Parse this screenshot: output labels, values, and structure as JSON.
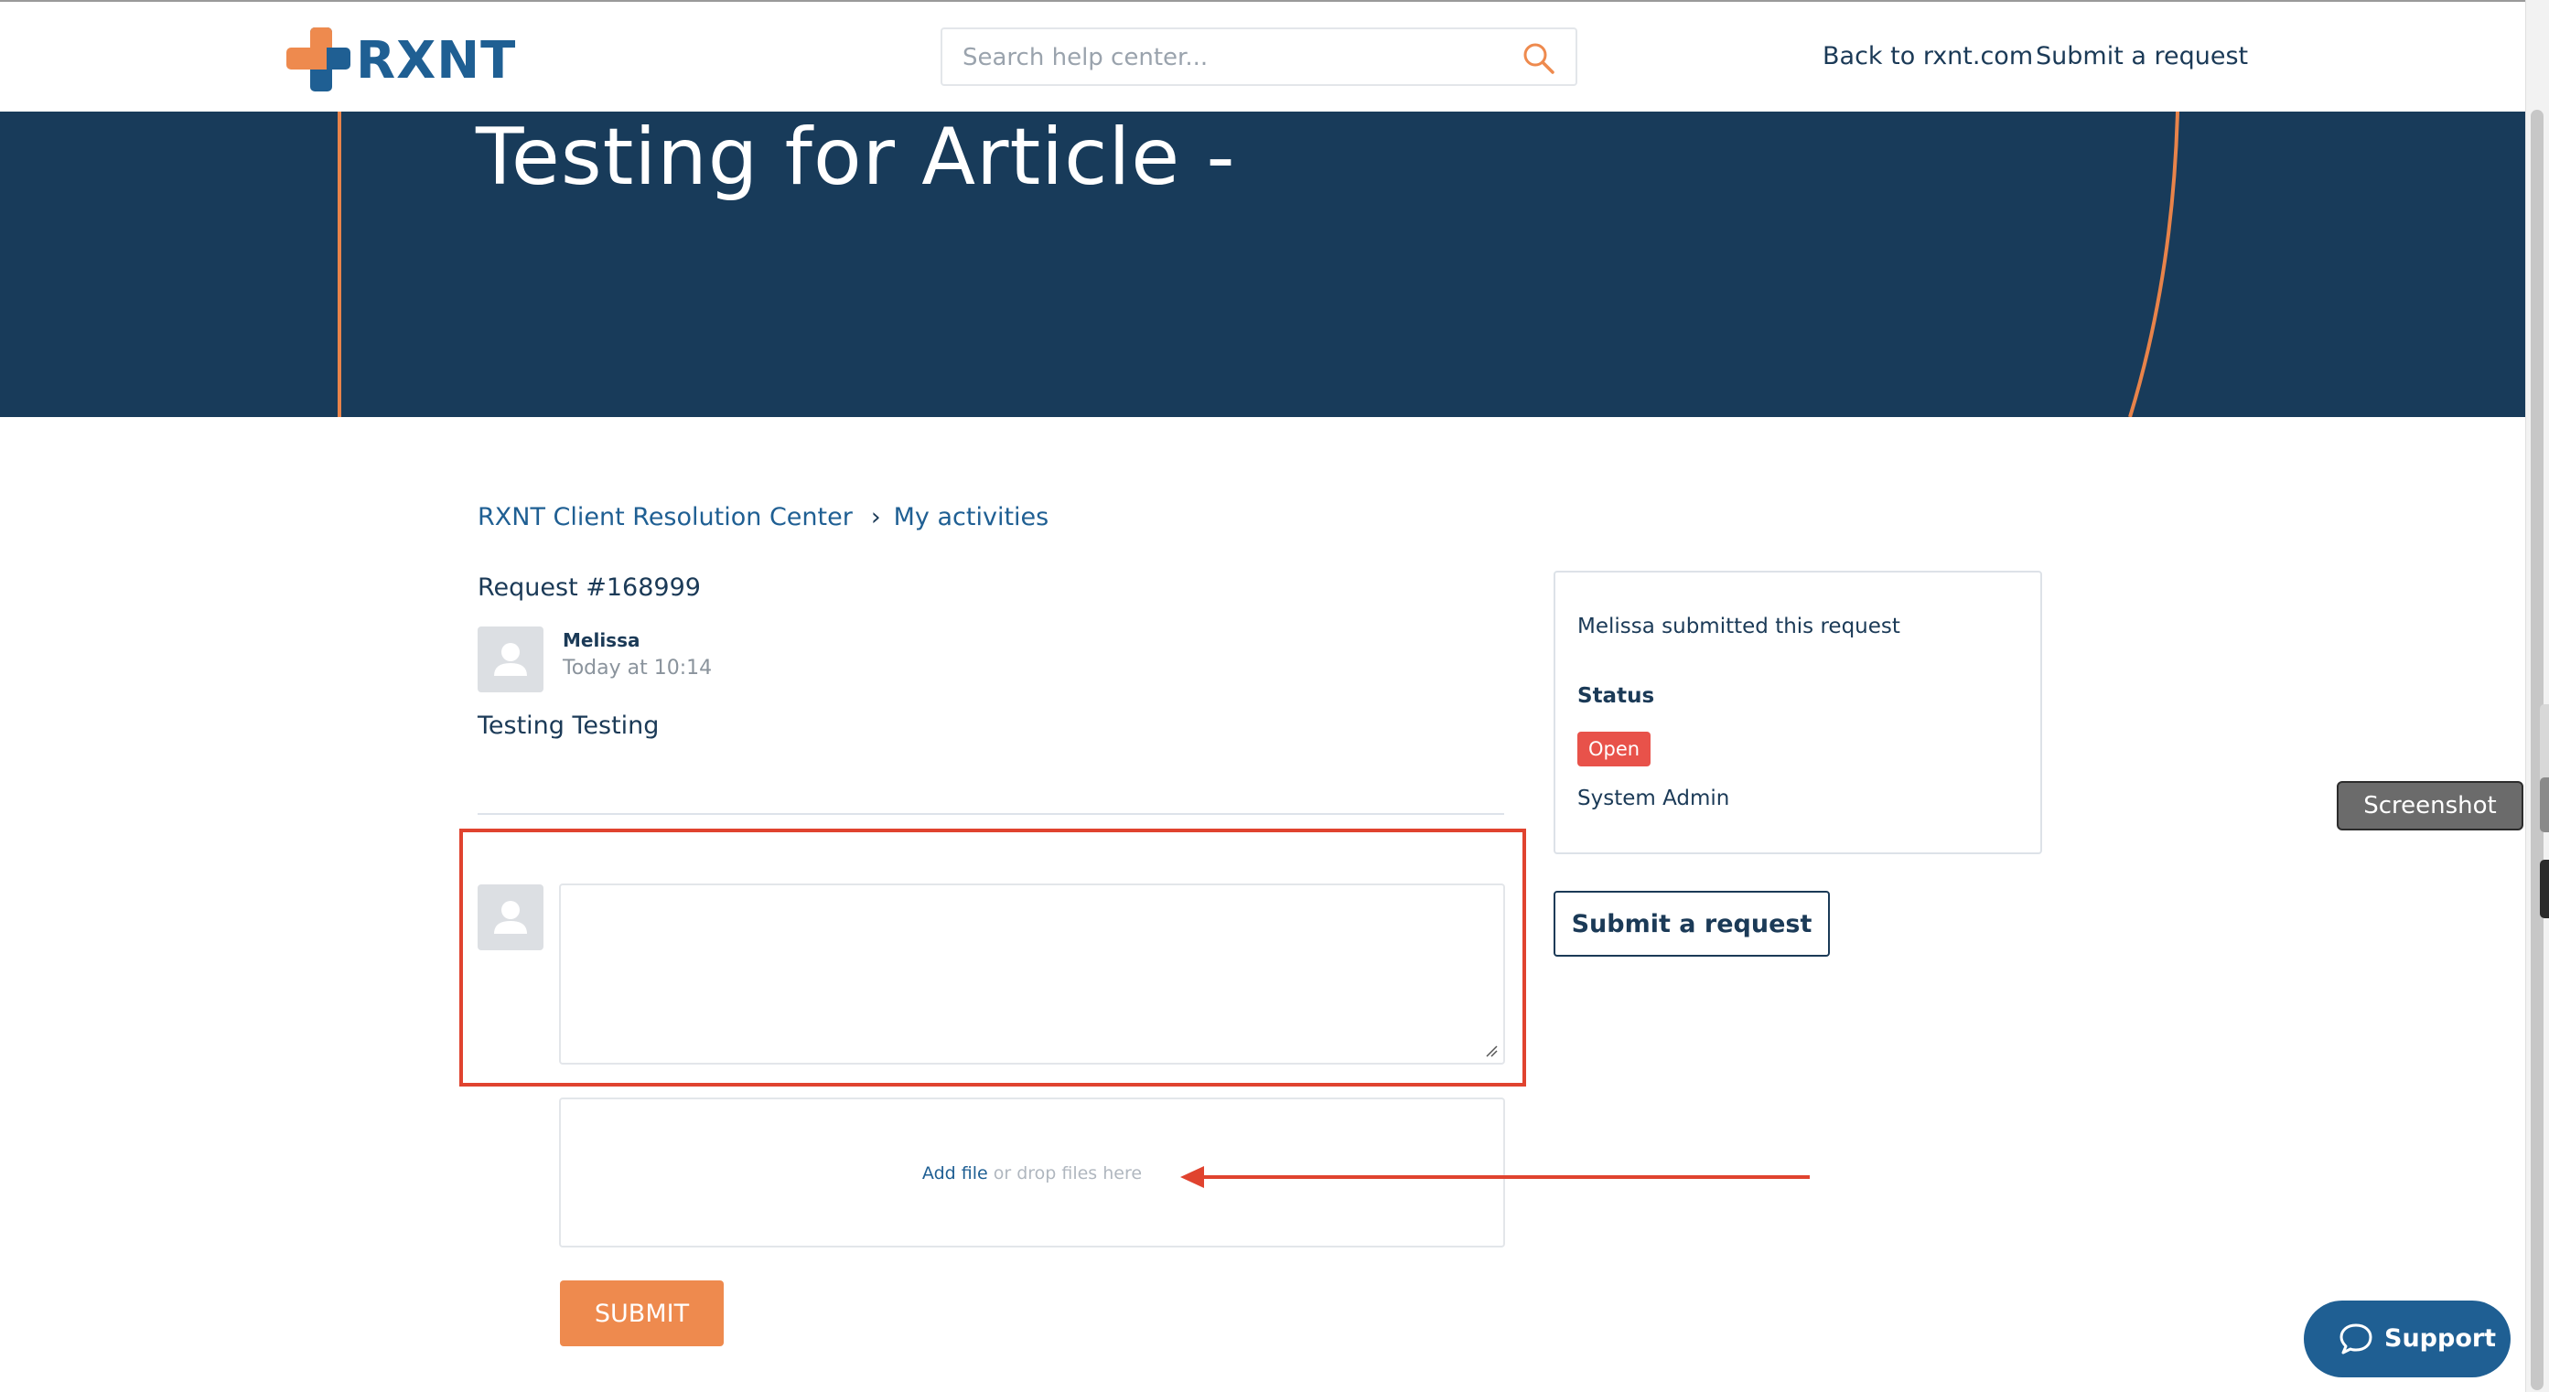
{
  "brand": {
    "name": "RXNT",
    "orange": "#ee8a4e",
    "navy": "#183b5a",
    "blue": "#1f5f93"
  },
  "search": {
    "placeholder": "Search help center..."
  },
  "nav": {
    "back": "Back to rxnt.com",
    "submit_request": "Submit a request"
  },
  "hero": {
    "title": "Testing for Article -"
  },
  "breadcrumb": [
    "RXNT Client Resolution Center",
    "My activities"
  ],
  "request": {
    "title": "Request #168999",
    "author": "Melissa",
    "time": "Today at 10:14",
    "body": "Testing Testing"
  },
  "reply": {
    "comment_value": "",
    "add_file": "Add file",
    "drop_hint": "or drop files here",
    "submit_label": "SUBMIT"
  },
  "sidebar": {
    "submitted_by": "Melissa submitted this request",
    "status_label": "Status",
    "status_value": "Open",
    "status_color": "#e8524a",
    "assignee": "System Admin",
    "submit_button": "Submit a request"
  },
  "tooltip": {
    "label": "Screenshot"
  },
  "support": {
    "label": "Support"
  },
  "annotations": {
    "highlight_color": "#e0432f"
  }
}
